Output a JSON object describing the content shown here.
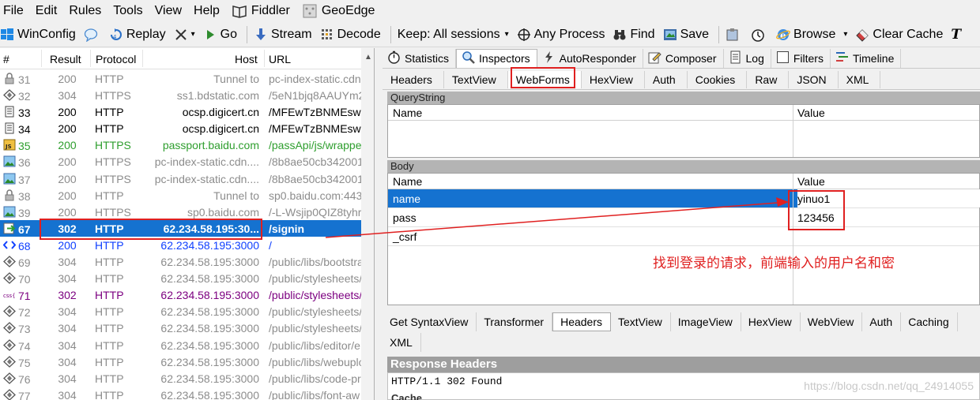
{
  "menu": [
    {
      "label": "File",
      "ul": "F"
    },
    {
      "label": "Edit",
      "ul": "E"
    },
    {
      "label": "Rules",
      "ul": "R"
    },
    {
      "label": "Tools",
      "ul": "T"
    },
    {
      "label": "View",
      "ul": "V"
    },
    {
      "label": "Help",
      "ul": "H"
    },
    {
      "label": "Fiddler",
      "icon": "fiddler-book-icon"
    },
    {
      "label": "GeoEdge",
      "icon": "geoedge-icon"
    }
  ],
  "toolbar": {
    "winconfig": "WinConfig",
    "replay": "Replay",
    "go": "Go",
    "stream": "Stream",
    "decode": "Decode",
    "keep": "Keep: All sessions",
    "any_process": "Any Process",
    "find": "Find",
    "save": "Save",
    "browse": "Browse",
    "clear_cache": "Clear Cache",
    "text_wizard": "T"
  },
  "sessions": {
    "headers": {
      "num": "#",
      "result": "Result",
      "protocol": "Protocol",
      "host": "Host",
      "url": "URL"
    },
    "rows": [
      {
        "num": "31",
        "result": "200",
        "protocol": "HTTP",
        "host": "Tunnel to",
        "url": "pc-index-static.cdn",
        "color": "gray",
        "icon": "lock-icon"
      },
      {
        "num": "32",
        "result": "304",
        "protocol": "HTTPS",
        "host": "ss1.bdstatic.com",
        "url": "/5eN1bjq8AAUYm2",
        "color": "gray",
        "icon": "diamond-icon"
      },
      {
        "num": "33",
        "result": "200",
        "protocol": "HTTP",
        "host": "ocsp.digicert.cn",
        "url": "/MFEwTzBNMEswST",
        "color": "black",
        "icon": "document-icon"
      },
      {
        "num": "34",
        "result": "200",
        "protocol": "HTTP",
        "host": "ocsp.digicert.cn",
        "url": "/MFEwTzBNMEswST",
        "color": "black",
        "icon": "document-icon"
      },
      {
        "num": "35",
        "result": "200",
        "protocol": "HTTPS",
        "host": "passport.baidu.com",
        "url": "/passApi/js/wrappe",
        "color": "green",
        "icon": "js-icon"
      },
      {
        "num": "36",
        "result": "200",
        "protocol": "HTTPS",
        "host": "pc-index-static.cdn....",
        "url": "/8b8ae50cb342001",
        "color": "gray",
        "icon": "image-icon"
      },
      {
        "num": "37",
        "result": "200",
        "protocol": "HTTPS",
        "host": "pc-index-static.cdn....",
        "url": "/8b8ae50cb342001",
        "color": "gray",
        "icon": "image-icon"
      },
      {
        "num": "38",
        "result": "200",
        "protocol": "HTTP",
        "host": "Tunnel to",
        "url": "sp0.baidu.com:443",
        "color": "gray",
        "icon": "lock-icon"
      },
      {
        "num": "39",
        "result": "200",
        "protocol": "HTTPS",
        "host": "sp0.baidu.com",
        "url": "/-L-Wsjip0QIZ8tyhr",
        "color": "gray",
        "icon": "image-icon"
      },
      {
        "num": "67",
        "result": "302",
        "protocol": "HTTP",
        "host": "62.234.58.195:30...",
        "url": "/signin",
        "color": "sel",
        "icon": "redirect-arrow-icon"
      },
      {
        "num": "68",
        "result": "200",
        "protocol": "HTTP",
        "host": "62.234.58.195:3000",
        "url": "/",
        "color": "blue",
        "icon": "html-icon"
      },
      {
        "num": "69",
        "result": "304",
        "protocol": "HTTP",
        "host": "62.234.58.195:3000",
        "url": "/public/libs/bootstra",
        "color": "gray",
        "icon": "diamond-icon"
      },
      {
        "num": "70",
        "result": "304",
        "protocol": "HTTP",
        "host": "62.234.58.195:3000",
        "url": "/public/stylesheets/",
        "color": "gray",
        "icon": "diamond-icon"
      },
      {
        "num": "71",
        "result": "302",
        "protocol": "HTTP",
        "host": "62.234.58.195:3000",
        "url": "/public/stylesheets/",
        "color": "purple",
        "icon": "css-icon"
      },
      {
        "num": "72",
        "result": "304",
        "protocol": "HTTP",
        "host": "62.234.58.195:3000",
        "url": "/public/stylesheets/",
        "color": "gray",
        "icon": "diamond-icon"
      },
      {
        "num": "73",
        "result": "304",
        "protocol": "HTTP",
        "host": "62.234.58.195:3000",
        "url": "/public/stylesheets/",
        "color": "gray",
        "icon": "diamond-icon"
      },
      {
        "num": "74",
        "result": "304",
        "protocol": "HTTP",
        "host": "62.234.58.195:3000",
        "url": "/public/libs/editor/e",
        "color": "gray",
        "icon": "diamond-icon"
      },
      {
        "num": "75",
        "result": "304",
        "protocol": "HTTP",
        "host": "62.234.58.195:3000",
        "url": "/public/libs/webuplo",
        "color": "gray",
        "icon": "diamond-icon"
      },
      {
        "num": "76",
        "result": "304",
        "protocol": "HTTP",
        "host": "62.234.58.195:3000",
        "url": "/public/libs/code-pre",
        "color": "gray",
        "icon": "diamond-icon"
      },
      {
        "num": "77",
        "result": "304",
        "protocol": "HTTP",
        "host": "62.234.58.195:3000",
        "url": "/public/libs/font-aw",
        "color": "gray",
        "icon": "diamond-icon"
      }
    ]
  },
  "inspector_tabs": [
    {
      "label": "Statistics",
      "icon": "stopwatch-icon"
    },
    {
      "label": "Inspectors",
      "icon": "magnifier-icon",
      "active": true
    },
    {
      "label": "AutoResponder",
      "icon": "lightning-icon"
    },
    {
      "label": "Composer",
      "icon": "pencil-icon"
    },
    {
      "label": "Log",
      "icon": "log-icon"
    },
    {
      "label": "Filters",
      "icon": "checkbox-icon"
    },
    {
      "label": "Timeline",
      "icon": "timeline-icon"
    }
  ],
  "request_tabs": [
    {
      "label": "Headers"
    },
    {
      "label": "TextView"
    },
    {
      "label": "WebForms",
      "active": true
    },
    {
      "label": "HexView"
    },
    {
      "label": "Auth"
    },
    {
      "label": "Cookies"
    },
    {
      "label": "Raw"
    },
    {
      "label": "JSON"
    },
    {
      "label": "XML"
    }
  ],
  "querystring": {
    "title": "QueryString",
    "name_col": "Name",
    "value_col": "Value"
  },
  "body": {
    "title": "Body",
    "name_col": "Name",
    "value_col": "Value",
    "rows": [
      {
        "name": "name",
        "value": "yinuo1"
      },
      {
        "name": "pass",
        "value": "123456"
      },
      {
        "name": "_csrf",
        "value": ""
      }
    ]
  },
  "annotation": "找到登录的请求，前端输入的用户名和密",
  "response_tabs_row1": [
    {
      "label": "Get SyntaxView"
    },
    {
      "label": "Transformer"
    },
    {
      "label": "Headers",
      "active": true
    },
    {
      "label": "TextView"
    },
    {
      "label": "ImageView"
    },
    {
      "label": "HexView"
    },
    {
      "label": "WebView"
    },
    {
      "label": "Auth"
    },
    {
      "label": "Caching"
    }
  ],
  "response_tabs_row2": [
    {
      "label": "XML"
    }
  ],
  "response_headers": {
    "title": "Response Headers",
    "status_line": "HTTP/1.1 302 Found",
    "cache_label": "Cache"
  },
  "watermark": "https://blog.csdn.net/qq_24914055",
  "colors": {
    "selection": "#1572d0",
    "highlight_red": "#e02020"
  }
}
